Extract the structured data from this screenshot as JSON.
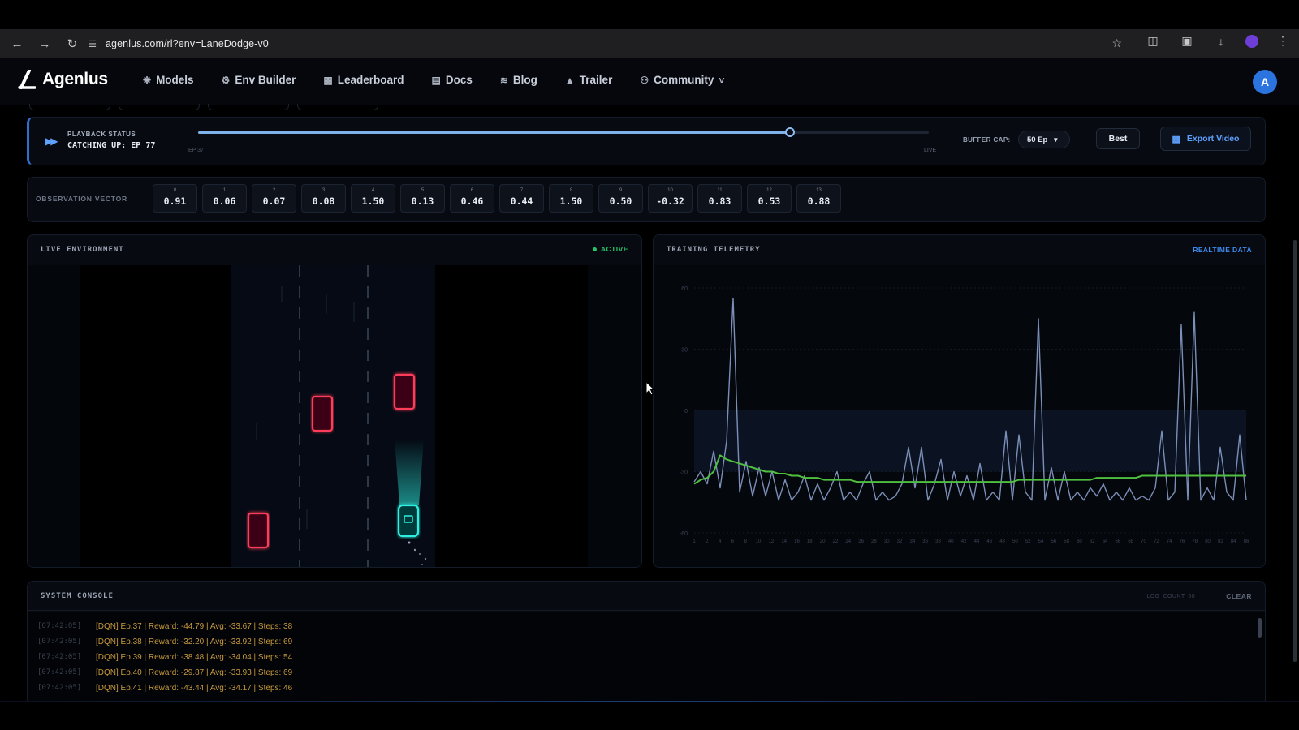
{
  "browser": {
    "url": "agenlus.com/rl?env=LaneDodge-v0",
    "icons": [
      "back-icon",
      "forward-icon",
      "reload-icon",
      "site-info-icon",
      "star-icon",
      "extensions-icon",
      "cast-icon",
      "download-icon",
      "profile-icon",
      "menu-icon"
    ]
  },
  "header": {
    "brand": "Agenlus",
    "nav": [
      {
        "label": "Models",
        "icon": "sparkle-icon"
      },
      {
        "label": "Env Builder",
        "icon": "builder-icon"
      },
      {
        "label": "Leaderboard",
        "icon": "bar-chart-icon"
      },
      {
        "label": "Docs",
        "icon": "doc-icon"
      },
      {
        "label": "Blog",
        "icon": "rss-icon"
      },
      {
        "label": "Trailer",
        "icon": "clapper-icon"
      },
      {
        "label": "Community",
        "icon": "people-icon"
      }
    ],
    "avatar_initial": "A"
  },
  "playback": {
    "label": "PLAYBACK STATUS",
    "status": "CATCHING UP: EP 77",
    "progress": 0.81,
    "range_start": "EP 37",
    "range_end": "LIVE",
    "buffer_label": "BUFFER CAP:",
    "buffer_value": "50 Ep",
    "best_label": "Best",
    "export_label": "Export Video"
  },
  "observation": {
    "label": "OBSERVATION VECTOR",
    "values": [
      {
        "idx": "0",
        "val": "0.91"
      },
      {
        "idx": "1",
        "val": "0.06"
      },
      {
        "idx": "2",
        "val": "0.07"
      },
      {
        "idx": "3",
        "val": "0.08"
      },
      {
        "idx": "4",
        "val": "1.50"
      },
      {
        "idx": "5",
        "val": "0.13"
      },
      {
        "idx": "6",
        "val": "0.46"
      },
      {
        "idx": "7",
        "val": "0.44"
      },
      {
        "idx": "8",
        "val": "1.50"
      },
      {
        "idx": "9",
        "val": "0.50"
      },
      {
        "idx": "10",
        "val": "-0.32"
      },
      {
        "idx": "11",
        "val": "0.83"
      },
      {
        "idx": "12",
        "val": "0.53"
      },
      {
        "idx": "13",
        "val": "0.88"
      }
    ]
  },
  "environment": {
    "title": "LIVE ENVIRONMENT",
    "status": "ACTIVE",
    "colors": {
      "road_edge": "#22a0ff",
      "obstacle": "#ff3c5a",
      "agent": "#2ef0e0"
    }
  },
  "telemetry": {
    "title": "TRAINING TELEMETRY",
    "badge": "REALTIME DATA"
  },
  "chart_data": {
    "type": "line",
    "y_ticks": [
      "60",
      "30",
      "0",
      "-30",
      "-60"
    ],
    "ylim": [
      -60,
      60
    ],
    "x_ticks": [
      "1",
      "2",
      "4",
      "6",
      "8",
      "10",
      "12",
      "14",
      "16",
      "18",
      "20",
      "22",
      "24",
      "26",
      "28",
      "30",
      "32",
      "34",
      "36",
      "38",
      "40",
      "42",
      "44",
      "46",
      "48",
      "50",
      "52",
      "54",
      "56",
      "58",
      "60",
      "62",
      "64",
      "66",
      "68",
      "70",
      "72",
      "74",
      "76",
      "78",
      "80",
      "82",
      "84",
      "86"
    ],
    "x": [
      1,
      2,
      3,
      4,
      5,
      6,
      7,
      8,
      9,
      10,
      11,
      12,
      13,
      14,
      15,
      16,
      17,
      18,
      19,
      20,
      21,
      22,
      23,
      24,
      25,
      26,
      27,
      28,
      29,
      30,
      31,
      32,
      33,
      34,
      35,
      36,
      37,
      38,
      39,
      40,
      41,
      42,
      43,
      44,
      45,
      46,
      47,
      48,
      49,
      50,
      51,
      52,
      53,
      54,
      55,
      56,
      57,
      58,
      59,
      60,
      61,
      62,
      63,
      64,
      65,
      66,
      67,
      68,
      69,
      70,
      71,
      72,
      73,
      74,
      75,
      76,
      77,
      78,
      79,
      80,
      81,
      82,
      83,
      84,
      85,
      86
    ],
    "series": [
      {
        "color": "#7b8fb8",
        "values": [
          -35,
          -30,
          -36,
          -20,
          -38,
          -15,
          55,
          -40,
          -25,
          -42,
          -28,
          -42,
          -30,
          -44,
          -34,
          -44,
          -40,
          -32,
          -44,
          -36,
          -44,
          -38,
          -30,
          -44,
          -40,
          -44,
          -36,
          -30,
          -44,
          -40,
          -44,
          -42,
          -36,
          -18,
          -38,
          -18,
          -44,
          -36,
          -24,
          -44,
          -30,
          -42,
          -32,
          -44,
          -26,
          -44,
          -40,
          -44,
          -10,
          -44,
          -12,
          -40,
          -44,
          45,
          -44,
          -28,
          -44,
          -30,
          -44,
          -40,
          -44,
          -38,
          -42,
          -36,
          -44,
          -40,
          -44,
          -38,
          -44,
          -42,
          -44,
          -38,
          -10,
          -44,
          -40,
          42,
          -44,
          48,
          -44,
          -38,
          -44,
          -18,
          -40,
          -44,
          -12,
          -44
        ]
      },
      {
        "color": "#4fbf3f",
        "values": [
          -36,
          -34,
          -33,
          -30,
          -22,
          -24,
          -25,
          -26,
          -27,
          -28,
          -29,
          -30,
          -30,
          -31,
          -31,
          -32,
          -32,
          -33,
          -33,
          -33,
          -34,
          -34,
          -34,
          -34,
          -34,
          -35,
          -35,
          -35,
          -35,
          -35,
          -35,
          -35,
          -35,
          -35,
          -35,
          -35,
          -35,
          -35,
          -35,
          -35,
          -35,
          -35,
          -35,
          -35,
          -35,
          -35,
          -35,
          -35,
          -35,
          -35,
          -34,
          -34,
          -34,
          -34,
          -34,
          -34,
          -34,
          -34,
          -34,
          -34,
          -34,
          -34,
          -33,
          -33,
          -33,
          -33,
          -33,
          -33,
          -33,
          -32,
          -32,
          -32,
          -32,
          -32,
          -32,
          -32,
          -32,
          -32,
          -32,
          -32,
          -32,
          -32,
          -32,
          -32,
          -32,
          -32
        ]
      }
    ]
  },
  "console": {
    "title": "SYSTEM CONSOLE",
    "log_count_label": "LOG_COUNT: 50",
    "clear_label": "CLEAR",
    "lines": [
      {
        "time": "[07:42:05]",
        "msg": "[DQN] Ep.37 | Reward: -44.79 | Avg: -33.67 | Steps: 38"
      },
      {
        "time": "[07:42:05]",
        "msg": "[DQN] Ep.38 | Reward: -32.20 | Avg: -33.92 | Steps: 69"
      },
      {
        "time": "[07:42:05]",
        "msg": "[DQN] Ep.39 | Reward: -38.48 | Avg: -34.04 | Steps: 54"
      },
      {
        "time": "[07:42:05]",
        "msg": "[DQN] Ep.40 | Reward: -29.87 | Avg: -33.93 | Steps: 69"
      },
      {
        "time": "[07:42:05]",
        "msg": "[DQN] Ep.41 | Reward: -43.44 | Avg: -34.17 | Steps: 46"
      }
    ]
  }
}
